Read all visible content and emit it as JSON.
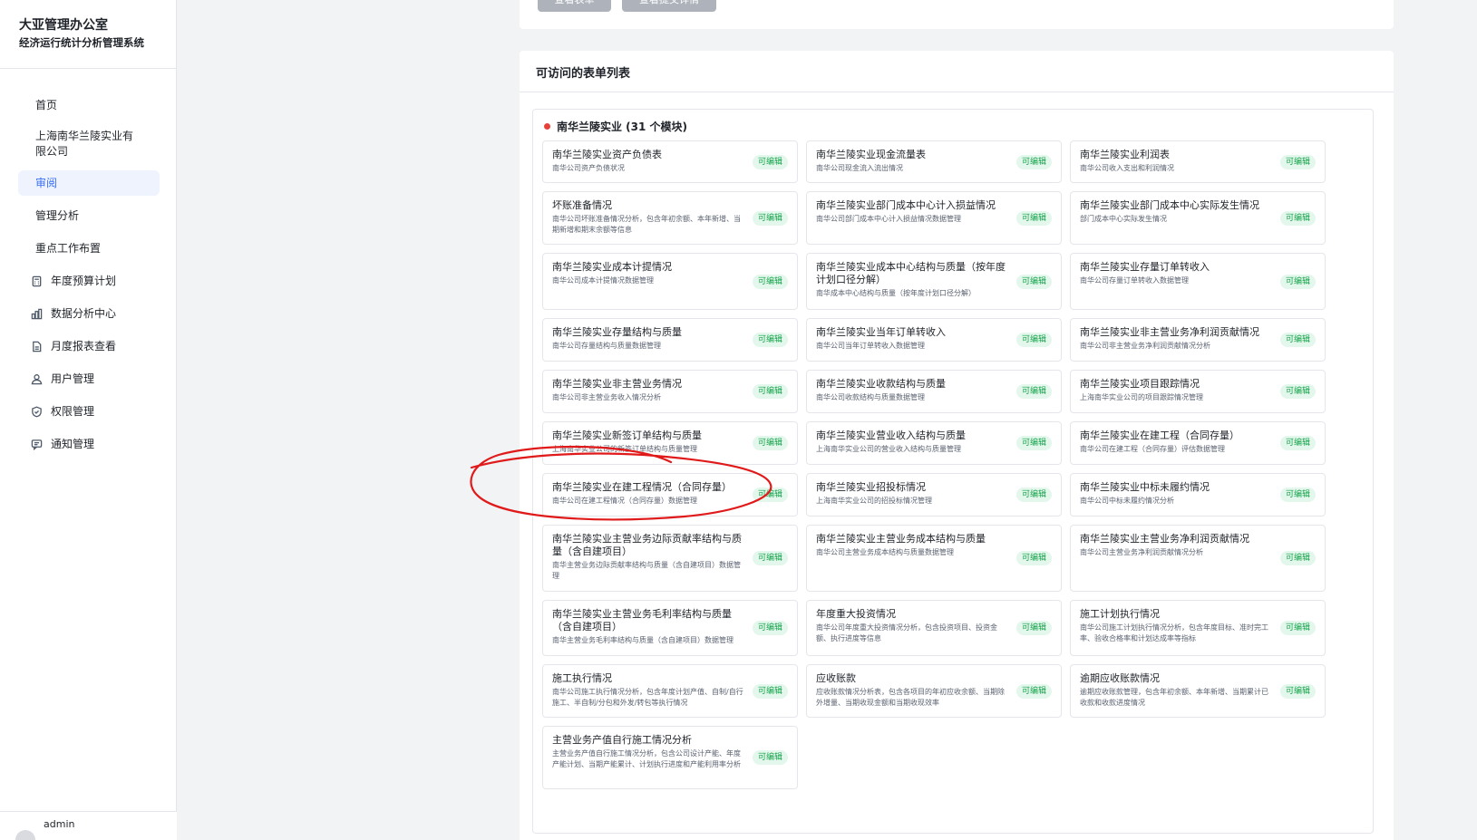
{
  "brand": {
    "title": "大亚管理办公室",
    "subtitle": "经济运行统计分析管理系统"
  },
  "sidebar": {
    "items": [
      {
        "label": "首页",
        "icon": ""
      },
      {
        "label": "上海南华兰陵实业有限公司",
        "icon": ""
      },
      {
        "label": "审阅",
        "icon": "",
        "active": true
      },
      {
        "label": "管理分析",
        "icon": ""
      },
      {
        "label": "重点工作布置",
        "icon": ""
      },
      {
        "label": "年度预算计划",
        "icon": "calculator-icon"
      },
      {
        "label": "数据分析中心",
        "icon": "bar-chart-icon"
      },
      {
        "label": "月度报表查看",
        "icon": "document-icon"
      },
      {
        "label": "用户管理",
        "icon": "users-icon"
      },
      {
        "label": "权限管理",
        "icon": "shield-icon"
      },
      {
        "label": "通知管理",
        "icon": "message-icon"
      }
    ],
    "user": "admin"
  },
  "top_buttons": [
    "查看表单",
    "查看提交详情"
  ],
  "main": {
    "title": "可访问的表单列表",
    "group": {
      "title": "南华兰陵实业 (31 个模块)",
      "badge_label": "可编辑",
      "forms": [
        {
          "name": "南华兰陵实业资产负债表",
          "desc": "南华公司资产负债状况"
        },
        {
          "name": "南华兰陵实业现金流量表",
          "desc": "南华公司现金流入流出情况"
        },
        {
          "name": "南华兰陵实业利润表",
          "desc": "南华公司收入支出和利润情况"
        },
        {
          "name": "坏账准备情况",
          "desc": "南华公司坏账准备情况分析，包含年初余额、本年新增、当期新增和期末余额等信息"
        },
        {
          "name": "南华兰陵实业部门成本中心计入损益情况",
          "desc": "南华公司部门成本中心计入损益情况数据管理"
        },
        {
          "name": "南华兰陵实业部门成本中心实际发生情况",
          "desc": "部门成本中心实际发生情况"
        },
        {
          "name": "南华兰陵实业成本计提情况",
          "desc": "南华公司成本计提情况数据管理"
        },
        {
          "name": "南华兰陵实业成本中心结构与质量（按年度计划口径分解）",
          "desc": "南华成本中心结构与质量（按年度计划口径分解）"
        },
        {
          "name": "南华兰陵实业存量订单转收入",
          "desc": "南华公司存量订单转收入数据管理"
        },
        {
          "name": "南华兰陵实业存量结构与质量",
          "desc": "南华公司存量结构与质量数据管理"
        },
        {
          "name": "南华兰陵实业当年订单转收入",
          "desc": "南华公司当年订单转收入数据管理"
        },
        {
          "name": "南华兰陵实业非主营业务净利润贡献情况",
          "desc": "南华公司非主营业务净利润贡献情况分析"
        },
        {
          "name": "南华兰陵实业非主营业务情况",
          "desc": "南华公司非主营业务收入情况分析"
        },
        {
          "name": "南华兰陵实业收款结构与质量",
          "desc": "南华公司收款结构与质量数据管理"
        },
        {
          "name": "南华兰陵实业项目跟踪情况",
          "desc": "上海南华实业公司的项目跟踪情况管理"
        },
        {
          "name": "南华兰陵实业新签订单结构与质量",
          "desc": "上海南华实业公司的新签订单结构与质量管理"
        },
        {
          "name": "南华兰陵实业营业收入结构与质量",
          "desc": "上海南华实业公司的营业收入结构与质量管理"
        },
        {
          "name": "南华兰陵实业在建工程（合同存量）",
          "desc": "南华公司在建工程（合同存量）评估数据管理"
        },
        {
          "name": "南华兰陵实业在建工程情况（合同存量）",
          "desc": "南华公司在建工程情况（合同存量）数据管理"
        },
        {
          "name": "南华兰陵实业招投标情况",
          "desc": "上海南华实业公司的招投标情况管理"
        },
        {
          "name": "南华兰陵实业中标未履约情况",
          "desc": "南华公司中标未履约情况分析"
        },
        {
          "name": "南华兰陵实业主营业务边际贡献率结构与质量（含自建项目）",
          "desc": "南华主营业务边际贡献率结构与质量（含自建项目）数据管理"
        },
        {
          "name": "南华兰陵实业主营业务成本结构与质量",
          "desc": "南华公司主营业务成本结构与质量数据管理"
        },
        {
          "name": "南华兰陵实业主营业务净利润贡献情况",
          "desc": "南华公司主营业务净利润贡献情况分析"
        },
        {
          "name": "南华兰陵实业主营业务毛利率结构与质量（含自建项目）",
          "desc": "南华主营业务毛利率结构与质量（含自建项目）数据管理"
        },
        {
          "name": "年度重大投资情况",
          "desc": "南华公司年度重大投资情况分析，包含投资项目、投资金额、执行进度等信息"
        },
        {
          "name": "施工计划执行情况",
          "desc": "南华公司施工计划执行情况分析，包含年度目标、准时完工率、验收合格率和计划达成率等指标"
        },
        {
          "name": "施工执行情况",
          "desc": "南华公司施工执行情况分析，包含年度计划产值、自制/自行施工、半自制/分包和外发/转包等执行情况"
        },
        {
          "name": "应收账款",
          "desc": "应收账款情况分析表，包含各项目的年初应收余额、当期除外增量、当期收现金额和当期收现效率"
        },
        {
          "name": "逾期应收账款情况",
          "desc": "逾期应收账款管理，包含年初余额、本年新增、当期累计已收款和收款进度情况"
        },
        {
          "name": "主营业务产值自行施工情况分析",
          "desc": "主营业务产值自行施工情况分析，包含公司设计产能、年度产能计划、当期产能累计、计划执行进度和产能利用率分析"
        }
      ]
    }
  }
}
